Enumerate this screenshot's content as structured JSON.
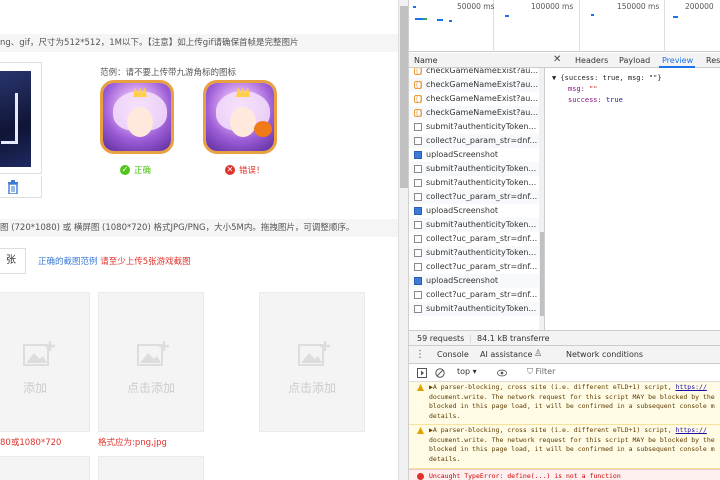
{
  "page": {
    "icon_note": "ng、gif，尺寸为512*512，1M以下。【注意】如上传gif请确保首帧是完整图片",
    "example_label": "范例：请不要上传带九游角标的图标",
    "correct_label": "正确",
    "wrong_label": "错误！",
    "screenshots_note": "图 (720*1080) 或 横屏图 (1080*720) 格式JPG/PNG，大小5M内。拖拽图片，可调整顺序。",
    "count_value": "张",
    "example_link": "正确的截图范例",
    "min_warning": "请至少上传5张游戏截图",
    "slots": [
      {
        "text": "添加",
        "caption": "80或1080*720"
      },
      {
        "text": "点击添加",
        "caption": "格式应为:png,jpg"
      },
      {
        "text": "点击添加",
        "caption": ""
      }
    ]
  },
  "devtools": {
    "timeline_ticks": [
      "50000 ms",
      "100000 ms",
      "150000 ms",
      "200000"
    ],
    "columns": {
      "name": "Name"
    },
    "detail_tabs": [
      "Headers",
      "Payload",
      "Preview",
      "Resp"
    ],
    "active_tab": "Preview",
    "requests": [
      {
        "type": "js",
        "name": "checkGameNameExist?au..."
      },
      {
        "type": "js",
        "name": "checkGameNameExist?au..."
      },
      {
        "type": "js",
        "name": "checkGameNameExist?au..."
      },
      {
        "type": "js",
        "name": "checkGameNameExist?au..."
      },
      {
        "type": "doc",
        "name": "submit?authenticityToken..."
      },
      {
        "type": "doc",
        "name": "collect?uc_param_str=dnf..."
      },
      {
        "type": "xhr",
        "name": "uploadScreenshot"
      },
      {
        "type": "doc",
        "name": "submit?authenticityToken..."
      },
      {
        "type": "doc",
        "name": "submit?authenticityToken..."
      },
      {
        "type": "doc",
        "name": "collect?uc_param_str=dnf..."
      },
      {
        "type": "xhr",
        "name": "uploadScreenshot"
      },
      {
        "type": "doc",
        "name": "submit?authenticityToken..."
      },
      {
        "type": "doc",
        "name": "collect?uc_param_str=dnf..."
      },
      {
        "type": "doc",
        "name": "submit?authenticityToken..."
      },
      {
        "type": "doc",
        "name": "collect?uc_param_str=dnf..."
      },
      {
        "type": "xhr",
        "name": "uploadScreenshot"
      },
      {
        "type": "doc",
        "name": "collect?uc_param_str=dnf..."
      },
      {
        "type": "doc",
        "name": "submit?authenticityToken..."
      }
    ],
    "preview": {
      "summary": "▼ {success: true, msg: \"\"}",
      "msg_key": "msg:",
      "msg_val": "\"\"",
      "success_key": "success:",
      "success_val": "true"
    },
    "status": {
      "requests": "59 requests",
      "transferred": "84.1 kB transferre"
    },
    "drawer_tabs": [
      "Console",
      "AI assistance",
      "Network conditions"
    ],
    "console_toolbar": {
      "context": "top",
      "filter_placeholder": "Filter"
    },
    "warnings": [
      {
        "line1": "▶A parser-blocking, cross site (i.e. different eTLD+1) script, ",
        "link": "https://",
        "line2": "document.write. The network request for this script MAY be blocked by the",
        "line3": "blocked in this page load, it will be confirmed in a subsequent console m",
        "line4": "details."
      },
      {
        "line1": "▶A parser-blocking, cross site (i.e. different eTLD+1) script, ",
        "link": "https://",
        "line2": "document.write. The network request for this script MAY be blocked by the",
        "line3": "blocked in this page load, it will be confirmed in a subsequent console m",
        "line4": "details."
      }
    ],
    "error": "Uncaught TypeError: define(...) is not a function"
  },
  "colors": {
    "accent": "#1a73e8",
    "success": "#52c41a",
    "error": "#e0322b",
    "warning_bg": "#fffbe5"
  }
}
